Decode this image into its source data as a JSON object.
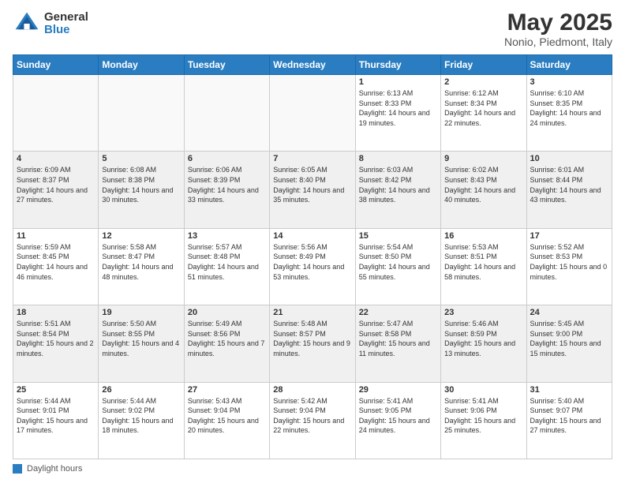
{
  "header": {
    "logo_general": "General",
    "logo_blue": "Blue",
    "title": "May 2025",
    "subtitle": "Nonio, Piedmont, Italy"
  },
  "days_of_week": [
    "Sunday",
    "Monday",
    "Tuesday",
    "Wednesday",
    "Thursday",
    "Friday",
    "Saturday"
  ],
  "footer": {
    "label": "Daylight hours"
  },
  "weeks": [
    [
      {
        "day": "",
        "info": ""
      },
      {
        "day": "",
        "info": ""
      },
      {
        "day": "",
        "info": ""
      },
      {
        "day": "",
        "info": ""
      },
      {
        "day": "1",
        "info": "Sunrise: 6:13 AM\nSunset: 8:33 PM\nDaylight: 14 hours and 19 minutes."
      },
      {
        "day": "2",
        "info": "Sunrise: 6:12 AM\nSunset: 8:34 PM\nDaylight: 14 hours and 22 minutes."
      },
      {
        "day": "3",
        "info": "Sunrise: 6:10 AM\nSunset: 8:35 PM\nDaylight: 14 hours and 24 minutes."
      }
    ],
    [
      {
        "day": "4",
        "info": "Sunrise: 6:09 AM\nSunset: 8:37 PM\nDaylight: 14 hours and 27 minutes."
      },
      {
        "day": "5",
        "info": "Sunrise: 6:08 AM\nSunset: 8:38 PM\nDaylight: 14 hours and 30 minutes."
      },
      {
        "day": "6",
        "info": "Sunrise: 6:06 AM\nSunset: 8:39 PM\nDaylight: 14 hours and 33 minutes."
      },
      {
        "day": "7",
        "info": "Sunrise: 6:05 AM\nSunset: 8:40 PM\nDaylight: 14 hours and 35 minutes."
      },
      {
        "day": "8",
        "info": "Sunrise: 6:03 AM\nSunset: 8:42 PM\nDaylight: 14 hours and 38 minutes."
      },
      {
        "day": "9",
        "info": "Sunrise: 6:02 AM\nSunset: 8:43 PM\nDaylight: 14 hours and 40 minutes."
      },
      {
        "day": "10",
        "info": "Sunrise: 6:01 AM\nSunset: 8:44 PM\nDaylight: 14 hours and 43 minutes."
      }
    ],
    [
      {
        "day": "11",
        "info": "Sunrise: 5:59 AM\nSunset: 8:45 PM\nDaylight: 14 hours and 46 minutes."
      },
      {
        "day": "12",
        "info": "Sunrise: 5:58 AM\nSunset: 8:47 PM\nDaylight: 14 hours and 48 minutes."
      },
      {
        "day": "13",
        "info": "Sunrise: 5:57 AM\nSunset: 8:48 PM\nDaylight: 14 hours and 51 minutes."
      },
      {
        "day": "14",
        "info": "Sunrise: 5:56 AM\nSunset: 8:49 PM\nDaylight: 14 hours and 53 minutes."
      },
      {
        "day": "15",
        "info": "Sunrise: 5:54 AM\nSunset: 8:50 PM\nDaylight: 14 hours and 55 minutes."
      },
      {
        "day": "16",
        "info": "Sunrise: 5:53 AM\nSunset: 8:51 PM\nDaylight: 14 hours and 58 minutes."
      },
      {
        "day": "17",
        "info": "Sunrise: 5:52 AM\nSunset: 8:53 PM\nDaylight: 15 hours and 0 minutes."
      }
    ],
    [
      {
        "day": "18",
        "info": "Sunrise: 5:51 AM\nSunset: 8:54 PM\nDaylight: 15 hours and 2 minutes."
      },
      {
        "day": "19",
        "info": "Sunrise: 5:50 AM\nSunset: 8:55 PM\nDaylight: 15 hours and 4 minutes."
      },
      {
        "day": "20",
        "info": "Sunrise: 5:49 AM\nSunset: 8:56 PM\nDaylight: 15 hours and 7 minutes."
      },
      {
        "day": "21",
        "info": "Sunrise: 5:48 AM\nSunset: 8:57 PM\nDaylight: 15 hours and 9 minutes."
      },
      {
        "day": "22",
        "info": "Sunrise: 5:47 AM\nSunset: 8:58 PM\nDaylight: 15 hours and 11 minutes."
      },
      {
        "day": "23",
        "info": "Sunrise: 5:46 AM\nSunset: 8:59 PM\nDaylight: 15 hours and 13 minutes."
      },
      {
        "day": "24",
        "info": "Sunrise: 5:45 AM\nSunset: 9:00 PM\nDaylight: 15 hours and 15 minutes."
      }
    ],
    [
      {
        "day": "25",
        "info": "Sunrise: 5:44 AM\nSunset: 9:01 PM\nDaylight: 15 hours and 17 minutes."
      },
      {
        "day": "26",
        "info": "Sunrise: 5:44 AM\nSunset: 9:02 PM\nDaylight: 15 hours and 18 minutes."
      },
      {
        "day": "27",
        "info": "Sunrise: 5:43 AM\nSunset: 9:04 PM\nDaylight: 15 hours and 20 minutes."
      },
      {
        "day": "28",
        "info": "Sunrise: 5:42 AM\nSunset: 9:04 PM\nDaylight: 15 hours and 22 minutes."
      },
      {
        "day": "29",
        "info": "Sunrise: 5:41 AM\nSunset: 9:05 PM\nDaylight: 15 hours and 24 minutes."
      },
      {
        "day": "30",
        "info": "Sunrise: 5:41 AM\nSunset: 9:06 PM\nDaylight: 15 hours and 25 minutes."
      },
      {
        "day": "31",
        "info": "Sunrise: 5:40 AM\nSunset: 9:07 PM\nDaylight: 15 hours and 27 minutes."
      }
    ]
  ]
}
